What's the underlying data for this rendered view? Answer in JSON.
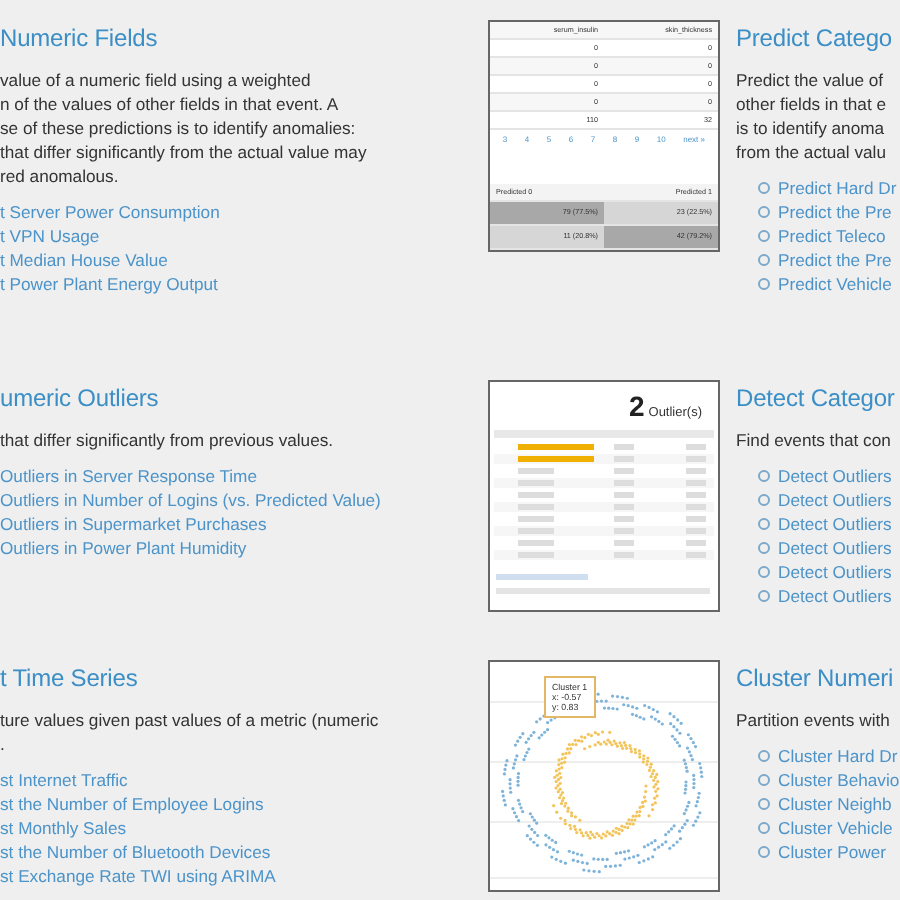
{
  "sections": [
    {
      "left": {
        "heading": "Numeric Fields",
        "description": [
          "value of a numeric field using a weighted",
          "n of the values of other fields in that event. A",
          "se of these predictions is to identify anomalies:",
          "that differ significantly from the actual value may",
          "red anomalous."
        ],
        "links": [
          "t Server Power Consumption",
          "t VPN Usage",
          "t Median House Value",
          "t Power Plant Energy Output"
        ]
      },
      "thumbnail": {
        "kind": "prediction_table",
        "columns": [
          "serum_insulin",
          "skin_thickness"
        ],
        "rows": [
          [
            "0",
            "0"
          ],
          [
            "0",
            "0"
          ],
          [
            "0",
            "0"
          ],
          [
            "0",
            "0"
          ],
          [
            "110",
            "32"
          ]
        ],
        "pages": [
          "3",
          "4",
          "5",
          "6",
          "7",
          "8",
          "9",
          "10",
          "next »"
        ],
        "matrix_columns": [
          "Predicted 0",
          "Predicted 1"
        ],
        "matrix_rows": [
          [
            "79 (77.5%)",
            "23 (22.5%)"
          ],
          [
            "11 (20.8%)",
            "42 (79.2%)"
          ]
        ]
      },
      "right": {
        "heading": "Predict Catego",
        "description": [
          "Predict the value of",
          "other fields in that e",
          "is to identify anoma",
          "from the actual valu"
        ],
        "links": [
          "Predict Hard Dr",
          "Predict the Pre",
          "Predict Teleco",
          "Predict the Pre",
          "Predict Vehicle"
        ]
      }
    },
    {
      "left": {
        "heading": "umeric Outliers",
        "description": [
          "that differ significantly from previous values."
        ],
        "links": [
          "Outliers in Server Response Time",
          "Outliers in Number of Logins (vs. Predicted Value)",
          "Outliers in Supermarket Purchases",
          "Outliers in Power Plant Humidity"
        ]
      },
      "thumbnail": {
        "kind": "outlier_report",
        "count": "2",
        "count_label": "Outlier(s)"
      },
      "right": {
        "heading": "Detect Categor",
        "description": [
          "Find events that con"
        ],
        "links": [
          "Detect Outliers",
          "Detect Outliers",
          "Detect Outliers",
          "Detect Outliers",
          "Detect Outliers",
          "Detect Outliers"
        ]
      }
    },
    {
      "left": {
        "heading": "t Time Series",
        "description": [
          "ture values given past values of a metric (numeric",
          "."
        ],
        "links": [
          "st Internet Traffic",
          "st the Number of Employee Logins",
          "st Monthly Sales",
          "st the Number of Bluetooth Devices",
          "st Exchange Rate TWI using ARIMA"
        ]
      },
      "thumbnail": {
        "kind": "scatter",
        "tooltip": [
          "Cluster 1",
          "x: -0.57",
          "y: 0.83"
        ]
      },
      "right": {
        "heading": "Cluster Numeri",
        "description": [
          "Partition events with"
        ],
        "links": [
          "Cluster Hard Dr",
          "Cluster Behavio",
          "Cluster Neighb",
          "Cluster Vehicle",
          "Cluster Power"
        ]
      }
    }
  ]
}
